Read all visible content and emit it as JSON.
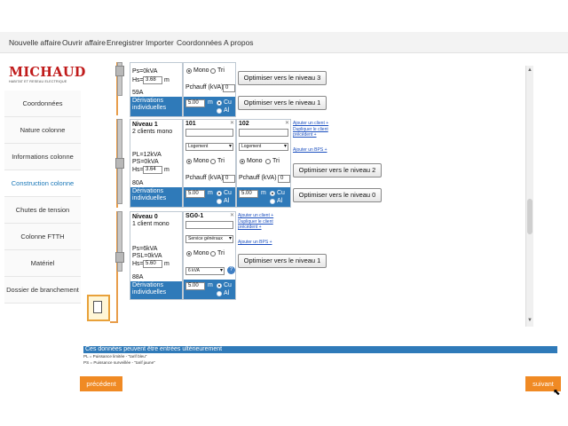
{
  "menu": [
    "Nouvelle affaire",
    "Ouvrir affaire",
    "Enregistrer",
    "Importer",
    "Coordonnées",
    "A propos"
  ],
  "logo": {
    "name": "MICHAUD",
    "tagline": "HABITAT ET RESEAU ELECTRIQUE"
  },
  "sidebar": [
    "Coordonnées",
    "Nature colonne",
    "Informations colonne",
    "Construction colonne",
    "Chutes de tension",
    "Colonne FTTH",
    "Matériel",
    "Dossier de branchement"
  ],
  "top_partial": {
    "ps": "Ps=0kVA",
    "hs_label": "Hs=",
    "hs_value": "3.68",
    "hs_unit": "m",
    "amps": "59A",
    "deriv": "Dérivations individuelles",
    "mono": "Mono",
    "tri": "Tri",
    "pchauff_label": "Pchauff (kVA)",
    "pchauff_value": "0",
    "deriv_value": "5.00",
    "deriv_unit": "m",
    "cu": "Cu",
    "al": "Al",
    "opt3": "Optimiser vers le niveau 3",
    "opt1": "Optimiser vers le niveau 1"
  },
  "niveau1": {
    "title": "Niveau 1",
    "subtitle": "2 clients mono",
    "pl": "PL=12kVA",
    "ps": "PS=0kVA",
    "hs_label": "Hs=",
    "hs_value": "3.64",
    "hs_unit": "m",
    "amps": "80A",
    "deriv": "Dérivations individuelles",
    "c1": {
      "name": "101",
      "select": "Logement",
      "mono": "Mono",
      "tri": "Tri",
      "pchauff_label": "Pchauff (kVA)",
      "pchauff_value": "0",
      "deriv_value": "5.00",
      "unit": "m",
      "cu": "Cu",
      "al": "Al"
    },
    "c2": {
      "name": "102",
      "select": "Logement",
      "mono": "Mono",
      "tri": "Tri",
      "pchauff_label": "Pchauff (kVA)",
      "pchauff_value": "0",
      "deriv_value": "5.00",
      "unit": "m",
      "cu": "Cu",
      "al": "Al"
    },
    "links": [
      "Ajouter un client +",
      "Dupliquer le client précédent +",
      "Ajouter un BPS +"
    ],
    "opt2": "Optimiser vers le niveau 2",
    "opt0": "Optimiser vers le niveau 0"
  },
  "niveau0": {
    "title": "Niveau 0",
    "subtitle": "1 client mono",
    "ps": "Ps=6kVA",
    "psl": "PSL=0kVA",
    "hs_label": "Hs=",
    "hs_value": "5.60",
    "hs_unit": "m",
    "amps": "88A",
    "deriv": "Dérivations individuelles",
    "c1": {
      "name": "SG0-1",
      "select": "Service généraux",
      "mono": "Mono",
      "tri": "Tri",
      "kva": "6 kVA",
      "deriv_value": "5.00",
      "unit": "m",
      "cu": "Cu",
      "al": "Al"
    },
    "links": [
      "Ajouter un client +",
      "Dupliquer le client précédent +",
      "Ajouter un BPS +"
    ],
    "opt1": "Optimiser vers le niveau 1"
  },
  "notice": "Ces données peuvent être entrées ultérieurement",
  "legend": [
    "PL = Puissance limitée - \"tarif bleu\"",
    "PS = Puissance surveillée - \"tarif jaune\""
  ],
  "buttons": {
    "prev": "précédent",
    "next": "suivant"
  },
  "colors": {
    "accent": "#2f7ab9",
    "brand": "#c01b1b",
    "orange": "#f08a24"
  }
}
